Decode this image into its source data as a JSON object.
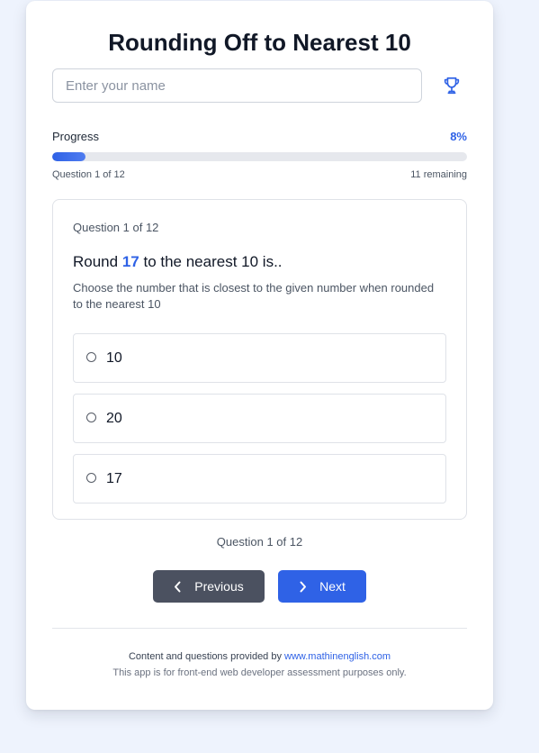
{
  "page": {
    "title": "Rounding Off to Nearest 10"
  },
  "name_input": {
    "placeholder": "Enter your name",
    "value": ""
  },
  "icons": {
    "trophy": "trophy-icon",
    "prev": "chevron-left-icon",
    "next": "chevron-right-icon"
  },
  "progress": {
    "label": "Progress",
    "percent_text": "8%",
    "fraction": 0.08,
    "counter": "Question 1 of 12",
    "remaining": "11 remaining"
  },
  "question": {
    "counter": "Question 1 of 12",
    "prefix": "Round ",
    "number": "17",
    "suffix": " to the nearest 10 is..",
    "help": "Choose the number that is closest to the given number when rounded to the nearest 10",
    "options": [
      {
        "label": "10"
      },
      {
        "label": "20"
      },
      {
        "label": "17"
      }
    ]
  },
  "pager": {
    "counter": "Question 1 of 12"
  },
  "nav": {
    "prev_label": "Previous",
    "next_label": "Next"
  },
  "footer": {
    "credit_text": "Content and questions provided by ",
    "credit_link": "www.mathinenglish.com",
    "note": "This app is for front-end web developer assessment purposes only."
  },
  "colors": {
    "accent": "#2f62e6",
    "background": "#eef3fd",
    "prev_button": "#4b5160"
  }
}
